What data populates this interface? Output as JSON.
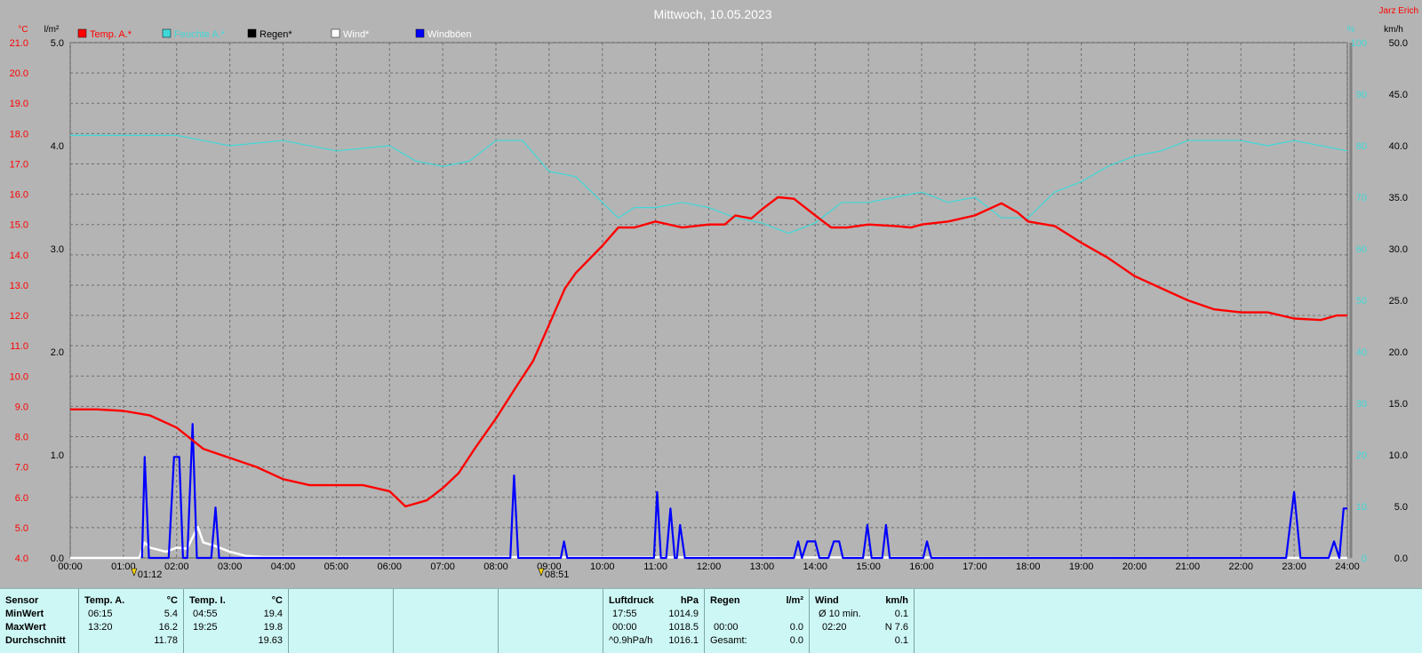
{
  "title": "Mittwoch, 10.05.2023",
  "station": "Jarz Erich",
  "colors": {
    "background": "#b4b4b4",
    "plot": "#b4b4b4",
    "grid": "#6e6e6e",
    "temp": "#ff0000",
    "humidity": "#3fd8d8",
    "rain": "#000000",
    "wind": "#ffffff",
    "gusts": "#0000ff",
    "stats_bg": "#cdf7f5"
  },
  "legend": [
    {
      "label": "Temp. A.*",
      "color": "#ff0000",
      "text_color": "#ff0000"
    },
    {
      "label": "Feuchte A.*",
      "color": "#3fd8d8",
      "text_color": "#3fd8d8"
    },
    {
      "label": "Regen*",
      "color": "#000000",
      "text_color": "#000000"
    },
    {
      "label": "Wind*",
      "color": "#ffffff",
      "text_color": "#ffffff"
    },
    {
      "label": "Windböen",
      "color": "#0000ff",
      "text_color": "#ffffff"
    }
  ],
  "axis_units": {
    "temp": "°C",
    "rain": "l/m²",
    "humidity": "%",
    "wind": "km/h"
  },
  "markers": [
    {
      "time": "01:12",
      "x_hours": 1.2
    },
    {
      "time": "08:51",
      "x_hours": 8.85
    }
  ],
  "chart_data": {
    "type": "line",
    "x_unit": "hours",
    "x_ticks": [
      "00:00",
      "01:00",
      "02:00",
      "03:00",
      "04:00",
      "05:00",
      "06:00",
      "07:00",
      "08:00",
      "09:00",
      "10:00",
      "11:00",
      "12:00",
      "13:00",
      "14:00",
      "15:00",
      "16:00",
      "17:00",
      "18:00",
      "19:00",
      "20:00",
      "21:00",
      "22:00",
      "23:00",
      "24:00"
    ],
    "xlim": [
      0,
      24
    ],
    "grid": true,
    "legend_position": "top-left",
    "axes": {
      "temp": {
        "range": [
          4,
          21
        ],
        "ticks": [
          "4.0",
          "5.0",
          "6.0",
          "7.0",
          "8.0",
          "9.0",
          "10.0",
          "11.0",
          "12.0",
          "13.0",
          "14.0",
          "15.0",
          "16.0",
          "17.0",
          "18.0",
          "19.0",
          "20.0",
          "21.0"
        ]
      },
      "rain": {
        "range": [
          0,
          5
        ],
        "ticks": [
          "0.0",
          "1.0",
          "2.0",
          "3.0",
          "4.0",
          "5.0"
        ]
      },
      "humidity": {
        "range": [
          0,
          100
        ],
        "ticks": [
          "0",
          "10",
          "20",
          "30",
          "40",
          "50",
          "60",
          "70",
          "80",
          "90",
          "100"
        ]
      },
      "wind": {
        "range": [
          0,
          50
        ],
        "ticks": [
          "0.0",
          "5.0",
          "10.0",
          "15.0",
          "20.0",
          "25.0",
          "30.0",
          "35.0",
          "40.0",
          "45.0",
          "50.0"
        ]
      }
    },
    "series": [
      {
        "name": "Temp. A.*",
        "axis": "temp",
        "points": [
          [
            0,
            8.9
          ],
          [
            0.5,
            8.9
          ],
          [
            1,
            8.85
          ],
          [
            1.5,
            8.7
          ],
          [
            2,
            8.3
          ],
          [
            2.5,
            7.6
          ],
          [
            3,
            7.3
          ],
          [
            3.5,
            7.0
          ],
          [
            4,
            6.6
          ],
          [
            4.5,
            6.4
          ],
          [
            5,
            6.4
          ],
          [
            5.5,
            6.4
          ],
          [
            6,
            6.2
          ],
          [
            6.3,
            5.7
          ],
          [
            6.7,
            5.9
          ],
          [
            7,
            6.3
          ],
          [
            7.3,
            6.8
          ],
          [
            7.6,
            7.6
          ],
          [
            8,
            8.6
          ],
          [
            8.4,
            9.7
          ],
          [
            8.7,
            10.5
          ],
          [
            9,
            11.7
          ],
          [
            9.3,
            12.9
          ],
          [
            9.5,
            13.4
          ],
          [
            10,
            14.3
          ],
          [
            10.3,
            14.9
          ],
          [
            10.6,
            14.9
          ],
          [
            11,
            15.1
          ],
          [
            11.5,
            14.9
          ],
          [
            12,
            15.0
          ],
          [
            12.3,
            15.0
          ],
          [
            12.5,
            15.3
          ],
          [
            12.8,
            15.2
          ],
          [
            13,
            15.5
          ],
          [
            13.3,
            15.9
          ],
          [
            13.6,
            15.85
          ],
          [
            14,
            15.3
          ],
          [
            14.3,
            14.9
          ],
          [
            14.6,
            14.9
          ],
          [
            15,
            15.0
          ],
          [
            15.5,
            14.95
          ],
          [
            15.8,
            14.9
          ],
          [
            16,
            15.0
          ],
          [
            16.5,
            15.1
          ],
          [
            17,
            15.3
          ],
          [
            17.5,
            15.7
          ],
          [
            17.8,
            15.4
          ],
          [
            18,
            15.1
          ],
          [
            18.5,
            14.95
          ],
          [
            19,
            14.4
          ],
          [
            19.5,
            13.9
          ],
          [
            20,
            13.3
          ],
          [
            20.5,
            12.9
          ],
          [
            21,
            12.5
          ],
          [
            21.5,
            12.2
          ],
          [
            22,
            12.1
          ],
          [
            22.5,
            12.1
          ],
          [
            23,
            11.9
          ],
          [
            23.5,
            11.85
          ],
          [
            23.8,
            12.0
          ],
          [
            24,
            12.0
          ]
        ]
      },
      {
        "name": "Feuchte A.*",
        "axis": "humidity",
        "points": [
          [
            0,
            82
          ],
          [
            1,
            82
          ],
          [
            2,
            82
          ],
          [
            3,
            80
          ],
          [
            4,
            81
          ],
          [
            5,
            79
          ],
          [
            6,
            80
          ],
          [
            6.5,
            77
          ],
          [
            7,
            76
          ],
          [
            7.5,
            77
          ],
          [
            8,
            81
          ],
          [
            8.5,
            81
          ],
          [
            9,
            75
          ],
          [
            9.5,
            74
          ],
          [
            10,
            69
          ],
          [
            10.3,
            66
          ],
          [
            10.6,
            68
          ],
          [
            11,
            68
          ],
          [
            11.5,
            69
          ],
          [
            12,
            68
          ],
          [
            12.5,
            66
          ],
          [
            13,
            65
          ],
          [
            13.5,
            63
          ],
          [
            14,
            65
          ],
          [
            14.5,
            69
          ],
          [
            15,
            69
          ],
          [
            15.5,
            70
          ],
          [
            16,
            71
          ],
          [
            16.5,
            69
          ],
          [
            17,
            70
          ],
          [
            17.5,
            66
          ],
          [
            18,
            66
          ],
          [
            18.5,
            71
          ],
          [
            19,
            73
          ],
          [
            19.5,
            76
          ],
          [
            20,
            78
          ],
          [
            20.5,
            79
          ],
          [
            21,
            81
          ],
          [
            21.5,
            81
          ],
          [
            22,
            81
          ],
          [
            22.5,
            80
          ],
          [
            23,
            81
          ],
          [
            23.5,
            80
          ],
          [
            24,
            79
          ]
        ]
      },
      {
        "name": "Wind*",
        "axis": "wind",
        "points": [
          [
            0,
            0
          ],
          [
            1.3,
            0
          ],
          [
            1.4,
            1.5
          ],
          [
            1.5,
            1.0
          ],
          [
            1.8,
            0.6
          ],
          [
            2,
            1.0
          ],
          [
            2.2,
            0.9
          ],
          [
            2.3,
            2.0
          ],
          [
            2.4,
            3.0
          ],
          [
            2.5,
            1.5
          ],
          [
            2.7,
            1.2
          ],
          [
            3,
            0.6
          ],
          [
            3.3,
            0.2
          ],
          [
            3.6,
            0.1
          ],
          [
            24,
            0
          ]
        ]
      },
      {
        "name": "Windböen",
        "axis": "wind",
        "points": [
          [
            1.35,
            0
          ],
          [
            1.4,
            9.8
          ],
          [
            1.48,
            0
          ],
          [
            1.85,
            0
          ],
          [
            1.95,
            9.8
          ],
          [
            2.05,
            9.8
          ],
          [
            2.12,
            0
          ],
          [
            2.2,
            0
          ],
          [
            2.3,
            13.0
          ],
          [
            2.38,
            0
          ],
          [
            2.65,
            0
          ],
          [
            2.73,
            4.9
          ],
          [
            2.8,
            0
          ],
          [
            8.27,
            0
          ],
          [
            8.34,
            8.0
          ],
          [
            8.42,
            0
          ],
          [
            9.22,
            0
          ],
          [
            9.28,
            1.6
          ],
          [
            9.34,
            0
          ],
          [
            10.97,
            0
          ],
          [
            11.03,
            6.4
          ],
          [
            11.1,
            0
          ],
          [
            11.2,
            0
          ],
          [
            11.28,
            4.8
          ],
          [
            11.36,
            0
          ],
          [
            11.4,
            0
          ],
          [
            11.46,
            3.2
          ],
          [
            11.55,
            0
          ],
          [
            13.6,
            0
          ],
          [
            13.68,
            1.6
          ],
          [
            13.75,
            0
          ],
          [
            13.85,
            1.6
          ],
          [
            14.0,
            1.6
          ],
          [
            14.08,
            0
          ],
          [
            14.25,
            0
          ],
          [
            14.35,
            1.6
          ],
          [
            14.45,
            1.6
          ],
          [
            14.52,
            0
          ],
          [
            14.9,
            0
          ],
          [
            14.98,
            3.2
          ],
          [
            15.06,
            0
          ],
          [
            15.26,
            0
          ],
          [
            15.33,
            3.2
          ],
          [
            15.4,
            0
          ],
          [
            16.03,
            0
          ],
          [
            16.1,
            1.6
          ],
          [
            16.18,
            0
          ],
          [
            22.85,
            0
          ],
          [
            23.0,
            6.4
          ],
          [
            23.12,
            0
          ],
          [
            23.65,
            0
          ],
          [
            23.75,
            1.6
          ],
          [
            23.85,
            0
          ],
          [
            23.93,
            4.8
          ],
          [
            24,
            4.8
          ]
        ]
      }
    ]
  },
  "stats": {
    "sensor": {
      "header": "Sensor",
      "rows": [
        "MinWert",
        "MaxWert",
        "Durchschnitt"
      ]
    },
    "temp_a": {
      "header": "Temp. A.",
      "unit": "°C",
      "rows": [
        [
          "06:15",
          "5.4"
        ],
        [
          "13:20",
          "16.2"
        ],
        [
          "",
          "11.78"
        ]
      ]
    },
    "temp_i": {
      "header": "Temp. I.",
      "unit": "°C",
      "rows": [
        [
          "04:55",
          "19.4"
        ],
        [
          "19:25",
          "19.8"
        ],
        [
          "",
          "19.63"
        ]
      ]
    },
    "pressure": {
      "header": "Luftdruck",
      "unit": "hPa",
      "rows": [
        [
          "17:55",
          "1014.9"
        ],
        [
          "00:00",
          "1018.5"
        ],
        [
          "^0.9hPa/h",
          "1016.1"
        ]
      ]
    },
    "rain": {
      "header": "Regen",
      "unit": "l/m²",
      "rows": [
        [
          "",
          ""
        ],
        [
          "00:00",
          "0.0"
        ],
        [
          "Gesamt:",
          "0.0"
        ]
      ]
    },
    "wind": {
      "header": "Wind",
      "unit": "km/h",
      "rows": [
        [
          "Ø 10 min.",
          "0.1"
        ],
        [
          "02:20",
          "N 7.6"
        ],
        [
          "",
          "0.1"
        ]
      ]
    }
  }
}
